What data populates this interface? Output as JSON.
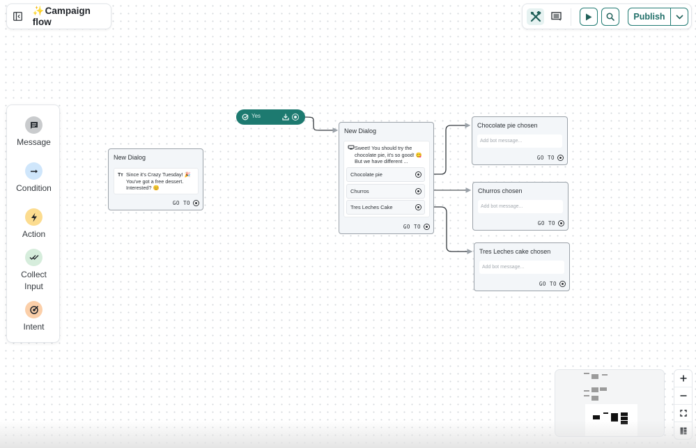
{
  "header": {
    "title_emoji": "✨",
    "title": "Campaign flow",
    "sidebar_toggle_icon": "sidebar-toggle-icon"
  },
  "toolbar": {
    "tools_icon": "tools-icon",
    "comment_icon": "comment-icon",
    "play_icon": "play-icon",
    "search_icon": "search-icon",
    "publish_label": "Publish",
    "publish_menu_icon": "chevron-down-icon"
  },
  "palette": {
    "items": [
      {
        "label": "Message",
        "icon": "message-icon",
        "color": "#c9cbcd"
      },
      {
        "label": "Condition",
        "icon": "arrow-right-icon",
        "color": "#cfe6fb"
      },
      {
        "label": "Action",
        "icon": "lightning-icon",
        "color": "#fcdc8f"
      },
      {
        "label": "Collect Input",
        "icon": "double-check-icon",
        "color": "#d6eddc"
      },
      {
        "label": "Intent",
        "icon": "target-icon",
        "color": "#fbcfa9"
      }
    ]
  },
  "canvas": {
    "yes_pill": {
      "label": "Yes",
      "color": "#1d7a70"
    },
    "nodes": [
      {
        "id": "dialog1",
        "title": "New Dialog",
        "message_type_icon": "Tт",
        "message": "Since it's Crazy Tuesday! 🎉 You've got a free dessert. Interested? 😊",
        "goto_label": "GO TO"
      },
      {
        "id": "dialog2",
        "title": "New Dialog",
        "message_type_icon": "carousel-icon",
        "message": "Sweet! You should try the chocolate pie, it's so good! 😋But we have different ...",
        "options": [
          "Chocolate pie",
          "Churros",
          "Tres Leches Cake"
        ],
        "goto_label": "GO TO"
      },
      {
        "id": "choc",
        "title": "Chocolate pie chosen",
        "placeholder": "Add bot message...",
        "goto_label": "GO TO"
      },
      {
        "id": "churros",
        "title": "Churros chosen",
        "placeholder": "Add bot message...",
        "goto_label": "GO TO"
      },
      {
        "id": "tres",
        "title": "Tres Leches cake chosen",
        "placeholder": "Add bot message...",
        "goto_label": "GO TO"
      }
    ]
  },
  "zoom_controls": {
    "zoom_in": "+",
    "zoom_out": "−",
    "fit_icon": "fit-view-icon",
    "layout_icon": "layout-icon"
  }
}
